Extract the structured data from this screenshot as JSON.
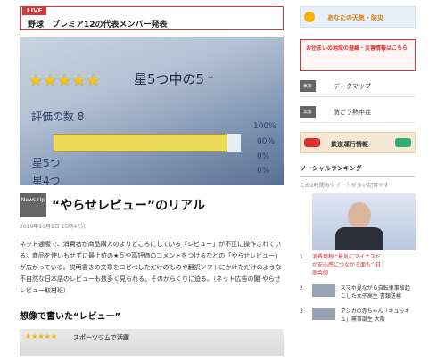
{
  "live": {
    "badge": "LIVE",
    "text": "野球　プレミア12の代表メンバー発表"
  },
  "hero": {
    "stars": "★★★★★",
    "star_label": "星5つ中の5",
    "review_count": "評価の数 8",
    "pcts": [
      "100%",
      "00%",
      "0%",
      "0%"
    ],
    "row_labels": [
      "星5つ",
      "星4つ"
    ]
  },
  "article": {
    "category": "News Up",
    "title": "“やらせレビュー”のリアル",
    "date": "2019年10月1日 15時47分",
    "body": "ネット通販で、消費者が商品購入のよりどころにしている「レビュー」が不正に操作されている。商品を使いもせずに最上位の★５や高評価のコメントをつけるなどの「やらせレビュー」が広がっている。説明書きの文章をコピペしただけのものや翻訳ソフトにかけただけのような不自然な日本語のレビューも数多く見られる。そのからくりに迫る。（ネット広告の闇 やらせレビュー取材班）",
    "subheading": "想像で書いた“レビュー”",
    "subimg_stars": "★★★★★",
    "subimg_text": "スポーツジムで活躍"
  },
  "sidebar": {
    "weather": "あなたの天気・防災",
    "bousai": "お住まいの地域の避難・災害情報はこちら",
    "items": [
      {
        "tag": "気象",
        "label": "データマップ"
      },
      {
        "tag": "気象",
        "label": "防ごう熱中症"
      }
    ],
    "train": "鉄道運行情報",
    "ranking_title": "ソーシャルランキング",
    "ranking_sub": "この2時間のツイートが多い記事です",
    "ranks": [
      {
        "n": "1",
        "text": "消費増税 “景気にマイナスだが安心感につながる面も” 日商会頭"
      },
      {
        "n": "2",
        "text": "スマホ見ながら自転車事故起こした女子高生 書類送検"
      },
      {
        "n": "3",
        "text": "アシカの赤ちゃん「キュッキュ」無事誕生 大阪"
      }
    ]
  }
}
